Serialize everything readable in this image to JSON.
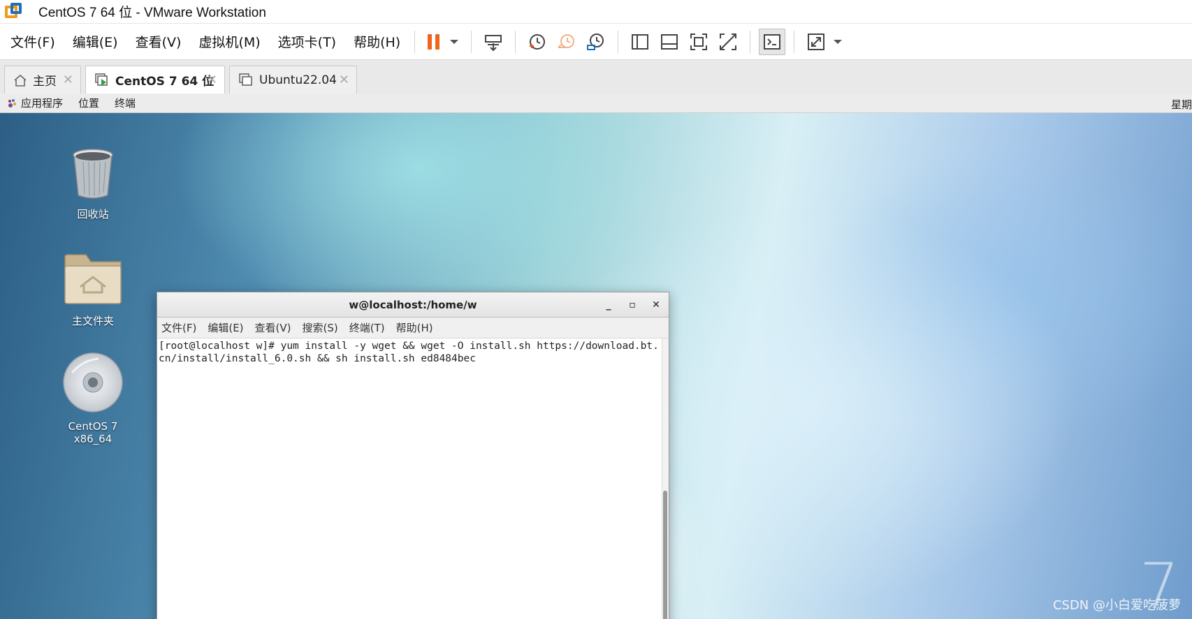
{
  "window": {
    "title": "CentOS 7 64 位 - VMware Workstation"
  },
  "menu": [
    {
      "label": "文件(F)"
    },
    {
      "label": "编辑(E)"
    },
    {
      "label": "查看(V)"
    },
    {
      "label": "虚拟机(M)"
    },
    {
      "label": "选项卡(T)"
    },
    {
      "label": "帮助(H)"
    }
  ],
  "tabs": [
    {
      "label": "主页",
      "icon": "home-icon"
    },
    {
      "label": "CentOS 7 64 位",
      "icon": "vm-running-icon",
      "active": true
    },
    {
      "label": "Ubuntu22.04",
      "icon": "vm-icon"
    }
  ],
  "gnome_panel": {
    "applications": "应用程序",
    "places": "位置",
    "terminal": "终端",
    "right_text": "星期"
  },
  "desktop_icons": [
    {
      "label": "回收站",
      "icon": "trash-icon"
    },
    {
      "label": "主文件夹",
      "icon": "home-folder-icon"
    },
    {
      "label": "CentOS 7 x86_64",
      "icon": "disc-icon"
    }
  ],
  "terminal": {
    "title": "w@localhost:/home/w",
    "menu": [
      "文件(F)",
      "编辑(E)",
      "查看(V)",
      "搜索(S)",
      "终端(T)",
      "帮助(H)"
    ],
    "content": "[root@localhost w]# yum install -y wget && wget -O install.sh https://download.bt.cn/install/install_6.0.sh && sh install.sh ed8484bec"
  },
  "watermark": "CSDN @小白爱吃菠萝",
  "brand_mark": "7",
  "colors": {
    "pause_orange": "#f0641e",
    "restore_orange": "#f29a6a",
    "accent_blue": "#1f6fbf"
  }
}
